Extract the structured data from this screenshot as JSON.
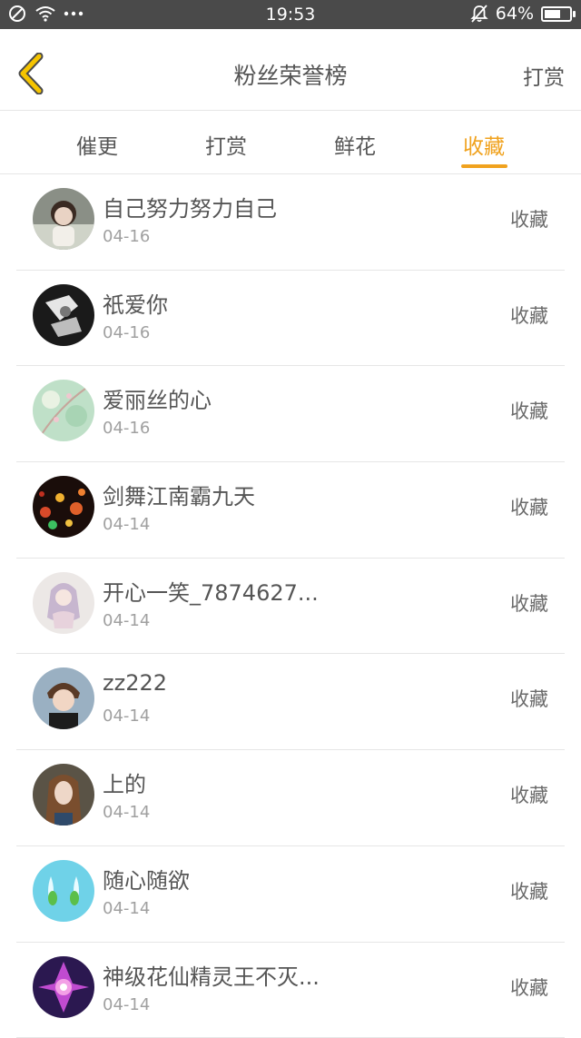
{
  "status_bar": {
    "time": "19:53",
    "battery_text": "64%",
    "battery_level": 0.64,
    "icons": [
      "dnd-circle-icon",
      "wifi-icon",
      "more-dots-icon",
      "bell-off-icon",
      "battery-icon"
    ]
  },
  "header": {
    "back_icon": "chevron-left-icon",
    "title": "粉丝荣誉榜",
    "action": "打赏"
  },
  "tabs": {
    "items": [
      {
        "label": "催更"
      },
      {
        "label": "打赏"
      },
      {
        "label": "鲜花"
      },
      {
        "label": "收藏"
      }
    ],
    "active_index": 3
  },
  "colors": {
    "accent": "#f0a21e",
    "text": "#555555",
    "muted": "#a0a0a0",
    "divider": "#e6e6e6",
    "status_bar": "#4a4a4a"
  },
  "list": {
    "items": [
      {
        "name": "自己努力努力自己",
        "date": "04-16",
        "tag": "收藏"
      },
      {
        "name": "祇爱你",
        "date": "04-16",
        "tag": "收藏"
      },
      {
        "name": "爱丽丝的心",
        "date": "04-16",
        "tag": "收藏"
      },
      {
        "name": "剑舞江南霸九天",
        "date": "04-14",
        "tag": "收藏"
      },
      {
        "name": "开心一笑_7874627...",
        "date": "04-14",
        "tag": "收藏"
      },
      {
        "name": "zz222",
        "date": "04-14",
        "tag": "收藏"
      },
      {
        "name": "上的",
        "date": "04-14",
        "tag": "收藏"
      },
      {
        "name": "随心随欲",
        "date": "04-14",
        "tag": "收藏"
      },
      {
        "name": "神级花仙精灵王不灭...",
        "date": "04-14",
        "tag": "收藏"
      }
    ]
  }
}
